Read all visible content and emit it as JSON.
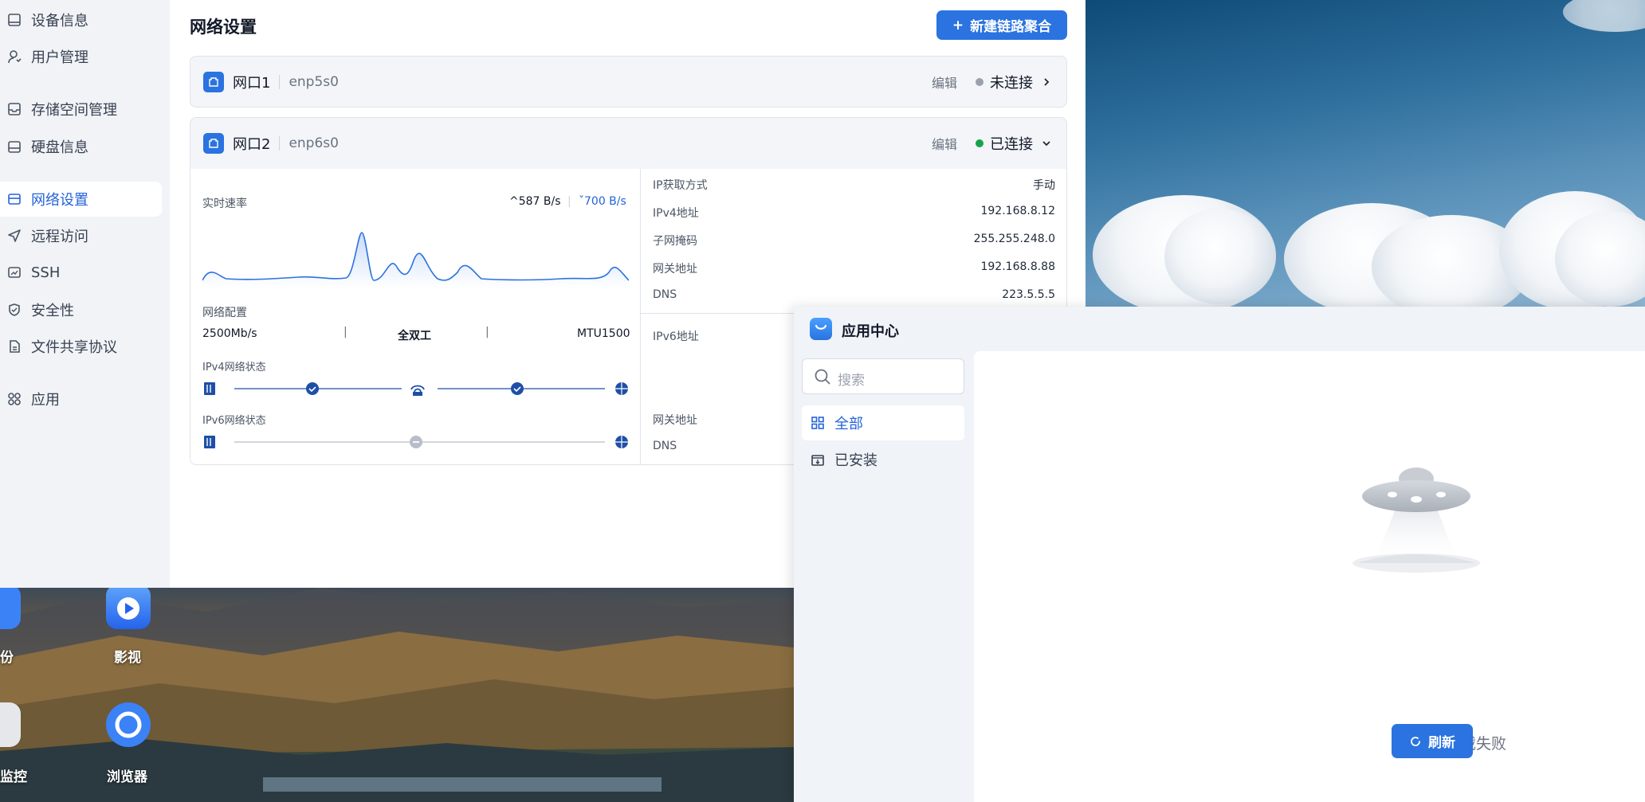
{
  "sidebar": {
    "items": [
      {
        "label": "设备信息",
        "icon": "device-info-icon"
      },
      {
        "label": "用户管理",
        "icon": "user-icon"
      },
      {
        "label": "存储空间管理",
        "icon": "storage-icon"
      },
      {
        "label": "硬盘信息",
        "icon": "disk-icon"
      },
      {
        "label": "网络设置",
        "icon": "network-icon",
        "active": true
      },
      {
        "label": "远程访问",
        "icon": "send-icon"
      },
      {
        "label": "SSH",
        "icon": "terminal-icon"
      },
      {
        "label": "安全性",
        "icon": "shield-icon"
      },
      {
        "label": "文件共享协议",
        "icon": "file-share-icon"
      },
      {
        "label": "应用",
        "icon": "apps-grid-icon"
      }
    ]
  },
  "main": {
    "title": "网络设置",
    "new_button_label": "新建链路聚合",
    "new_button_icon": "+"
  },
  "ports": [
    {
      "name": "网口1",
      "device": "enp5s0",
      "edit_label": "编辑",
      "status": "未连接",
      "status_color": "#9aa1ab",
      "expanded": false
    },
    {
      "name": "网口2",
      "device": "enp6s0",
      "edit_label": "编辑",
      "status": "已连接",
      "status_color": "#16a34a",
      "expanded": true
    }
  ],
  "port2_detail": {
    "realtime_label": "实时速率",
    "upload": "587 B/s",
    "download": "700 B/s",
    "net_config_label": "网络配置",
    "speed": "2500Mb/s",
    "duplex": "全双工",
    "mtu": "MTU1500",
    "ipv4_status_label": "IPv4网络状态",
    "ipv6_status_label": "IPv6网络状态",
    "ipv4": [
      {
        "key": "IP获取方式",
        "value": "手动"
      },
      {
        "key": "IPv4地址",
        "value": "192.168.8.12"
      },
      {
        "key": "子网掩码",
        "value": "255.255.248.0"
      },
      {
        "key": "网关地址",
        "value": "192.168.8.88"
      },
      {
        "key": "DNS",
        "value": "223.5.5.5"
      }
    ],
    "ipv6_keys": {
      "address": "IPv6地址",
      "gateway": "网关地址",
      "dns": "DNS"
    }
  },
  "desktop": {
    "icons": [
      {
        "label": "份",
        "icon": "backup-icon"
      },
      {
        "label": "影视",
        "icon": "video-icon"
      },
      {
        "label": "监控",
        "icon": "monitor-icon"
      },
      {
        "label": "浏览器",
        "icon": "browser-icon"
      }
    ]
  },
  "app_center": {
    "title": "应用中心",
    "search_placeholder": "搜索",
    "categories": [
      {
        "label": "全部",
        "icon": "grid-icon",
        "active": true
      },
      {
        "label": "已安装",
        "icon": "installed-icon"
      }
    ],
    "fail_text": "加载失败",
    "refresh_label": "刷新"
  },
  "colors": {
    "accent": "#2a73e0",
    "connected": "#16a34a",
    "disconnected": "#9aa1ab"
  }
}
